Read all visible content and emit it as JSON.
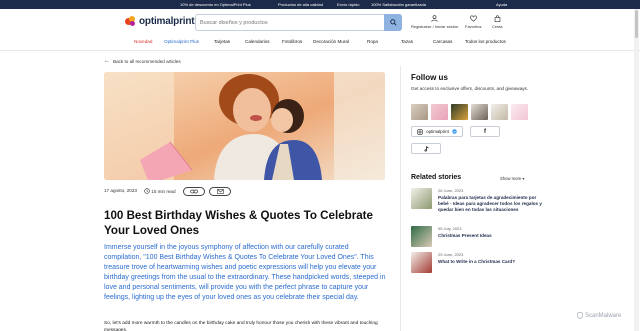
{
  "promo": {
    "lang": "",
    "items": [
      "10% de descuento en OptimalPrint Plus",
      "Productos de alta calidad",
      "Envío rápido",
      "100% Satisfacción garantizada",
      "Ayuda"
    ]
  },
  "header": {
    "logo_text": "optimalprint",
    "search_placeholder": "Buscar diseños y productos",
    "actions": [
      {
        "label": "Registrarse / Iniciar sesión",
        "icon": "user-icon"
      },
      {
        "label": "Favoritos",
        "icon": "heart-icon"
      },
      {
        "label": "Cesta",
        "icon": "bag-icon"
      }
    ]
  },
  "nav": {
    "items": [
      {
        "label": "Novedad"
      },
      {
        "label": "Optimalprint Plus"
      },
      {
        "label": "Tarjetas"
      },
      {
        "label": "Calendarios"
      },
      {
        "label": "Fotolibros"
      },
      {
        "label": "Decoración Mural"
      },
      {
        "label": "Ropa"
      },
      {
        "label": "Tazas"
      },
      {
        "label": "Carcasas"
      },
      {
        "label": "Todos los productos"
      }
    ]
  },
  "article": {
    "back_label": "Back to all recommended articles",
    "date": "17 agosto, 2023",
    "read_time": "15 min read",
    "title": "100 Best Birthday Wishes & Quotes To Celebrate Your Loved Ones",
    "intro": "Immerse yourself in the joyous symphony of affection with our carefully curated compilation, \"100 Best Birthday Wishes & Quotes To Celebrate Your Loved Ones\". This treasure trove of heartwarming wishes and poetic expressions will help you elevate your birthday greetings from the usual to the extraordinary. These handpicked words, steeped in love and personal sentiments, will provide you with the perfect phrase to capture your feelings, lighting up the eyes of your loved ones as you celebrate their special day.",
    "body": "So, let's add more warmth to the candles on the birthday cake and truly honour those you cherish with these vibrant and touching messages."
  },
  "follow": {
    "title": "Follow us",
    "subtitle": "Get access to exclusive offers, discounts, and giveaways.",
    "instagram_handle": "optimalprint",
    "social": [
      "instagram-icon",
      "facebook-icon",
      "tiktok-icon"
    ]
  },
  "related": {
    "title": "Related stories",
    "show_more": "Show more",
    "items": [
      {
        "date": "26 June, 2023",
        "title": "Palabras para tarjetas de agradecimiento por bebé - Ideas para agradecer todos los regalos y quedar bien en todas las situaciones"
      },
      {
        "date": "05 July, 2023",
        "title": "Christmas Present Ideas"
      },
      {
        "date": "29 June, 2023",
        "title": "What to Write in a Christmas Card?"
      }
    ]
  },
  "watermark": "ScanMalware"
}
